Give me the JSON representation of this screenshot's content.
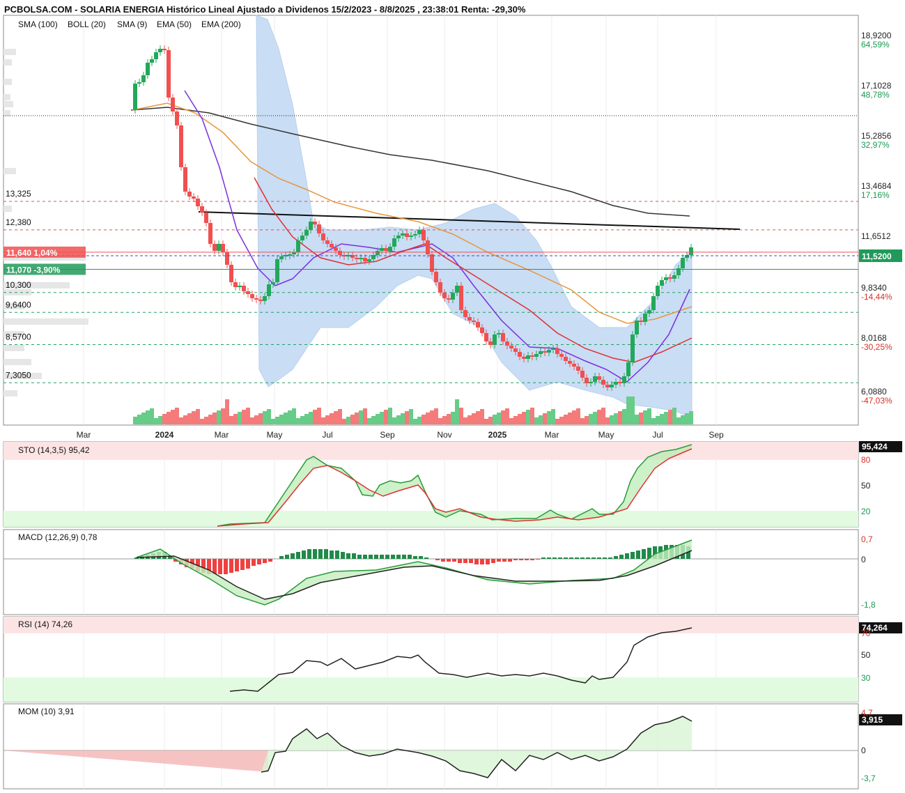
{
  "title": "PCBOLSA.COM - SOLARIA ENERGIA Histórico Lineal Ajustado a Dividenos 15/2/2023 - 8/8/2025 , 23:38:01 Renta: -29,30%",
  "legend": [
    {
      "label": "SMA (100)",
      "color": "#8ec5ea"
    },
    {
      "label": "BOLL (20)",
      "color": "#e03030"
    },
    {
      "label": "SMA (9)",
      "color": "#7a2ee0"
    },
    {
      "label": "EMA (50)",
      "color": "#e8963a"
    },
    {
      "label": "EMA (200)",
      "color": "#222222"
    }
  ],
  "colors": {
    "up": "#22a85a",
    "down": "#f05050",
    "band": "#c9ddf5",
    "stoFill": "#fde4e4",
    "okFill": "#e2fbe0"
  },
  "price_axis": [
    {
      "value": "18,9200",
      "pct": "64,59%",
      "pc": "g"
    },
    {
      "value": "17,1028",
      "pct": "48,78%",
      "pc": "g"
    },
    {
      "value": "15,2856",
      "pct": "32,97%",
      "pc": "g"
    },
    {
      "value": "13,4684",
      "pct": "17,16%",
      "pc": "g"
    },
    {
      "value": "11,6512",
      "pct": "",
      "pc": "g"
    },
    {
      "value": "9,8340",
      "pct": "-14,44%",
      "pc": "r"
    },
    {
      "value": "8,0168",
      "pct": "-30,25%",
      "pc": "r"
    },
    {
      "value": "6,0880",
      "pct": "-47,03%",
      "pc": "r"
    }
  ],
  "current_price": "11,5200",
  "levels": [
    {
      "label": "13,325",
      "value": 13.325
    },
    {
      "label": "12,380",
      "value": 12.38
    },
    {
      "label": "10,300",
      "value": 10.3
    },
    {
      "label": "9,6400",
      "value": 9.64
    },
    {
      "label": "8,5700",
      "value": 8.57
    },
    {
      "label": "7,3050",
      "value": 7.305
    }
  ],
  "tags": [
    {
      "text": "11,640  1,04%",
      "value": 11.64,
      "color": "#f05050"
    },
    {
      "text": "11,070  -3,90%",
      "value": 11.07,
      "color": "#229a5a"
    }
  ],
  "months": [
    "Mar",
    "2024",
    "Mar",
    "May",
    "Jul",
    "Sep",
    "Nov",
    "2025",
    "Mar",
    "May",
    "Jul",
    "Sep"
  ],
  "panels": {
    "sto": {
      "label": "STO (14,3,5)",
      "value": "95,42",
      "current": "95,424",
      "ticks": [
        "80",
        "50",
        "20"
      ]
    },
    "macd": {
      "label": "MACD (12,26,9)",
      "value": "0,78",
      "ticks": [
        "0,7",
        "0",
        "-1,8"
      ]
    },
    "rsi": {
      "label": "RSI (14)",
      "value": "74,26",
      "current": "74,264",
      "ticks": [
        "70",
        "50",
        "30"
      ]
    },
    "mom": {
      "label": "MOM (10)",
      "value": "3,91",
      "current": "3,915",
      "ticks": [
        "4,7",
        "0",
        "-3,7"
      ]
    }
  },
  "chart_data": {
    "type": "line",
    "x": [
      "2023-12",
      "2024-01",
      "2024-02",
      "2024-03",
      "2024-04",
      "2024-05",
      "2024-06",
      "2024-07",
      "2024-08",
      "2024-09",
      "2024-10",
      "2024-11",
      "2024-12",
      "2025-01",
      "2025-02",
      "2025-03",
      "2025-04",
      "2025-05",
      "2025-06",
      "2025-07",
      "2025-08"
    ],
    "series": [
      {
        "name": "Close",
        "values": [
          16.6,
          18.6,
          14.2,
          12.5,
          10.2,
          9.7,
          11.0,
          11.9,
          11.1,
          11.6,
          11.8,
          10.0,
          8.5,
          7.8,
          7.4,
          7.2,
          6.6,
          6.9,
          9.9,
          10.4,
          11.52
        ]
      },
      {
        "name": "EMA (200)",
        "values": [
          16.8,
          16.7,
          16.6,
          16.4,
          16.1,
          15.9,
          15.7,
          15.5,
          15.3,
          15.1,
          14.9,
          14.6,
          14.3,
          14.0,
          13.8,
          13.5,
          13.3,
          13.0,
          12.8,
          12.65,
          12.6
        ]
      },
      {
        "name": "EMA (50)",
        "values": [
          16.6,
          16.8,
          16.5,
          15.3,
          14.1,
          13.3,
          12.9,
          12.6,
          12.3,
          12.1,
          11.9,
          11.5,
          11.0,
          10.3,
          9.8,
          9.3,
          8.8,
          8.3,
          8.4,
          8.8,
          9.1
        ]
      }
    ],
    "ylim": [
      5.9,
      19.5
    ],
    "volume_panel": true
  }
}
